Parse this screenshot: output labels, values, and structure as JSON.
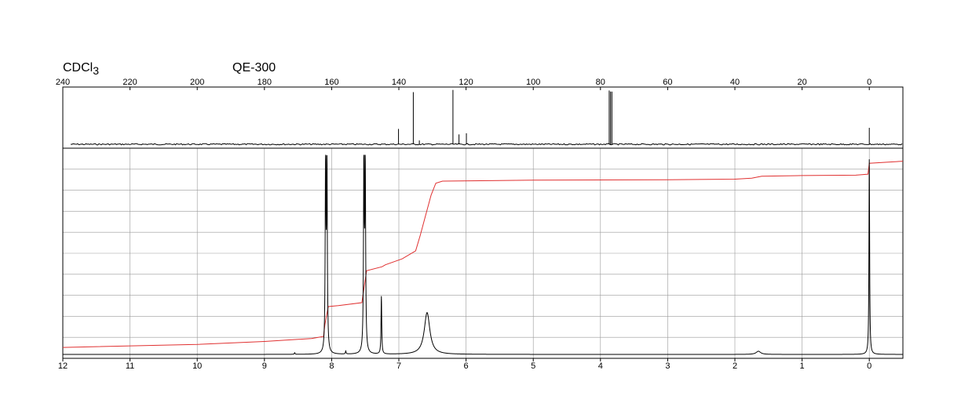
{
  "header": {
    "solvent": "CDCl",
    "solvent_subscript": "3",
    "instrument": "QE-300"
  },
  "chart_data": [
    {
      "type": "line",
      "title": "",
      "xlabel": "",
      "ylabel": "",
      "x_reversed": true,
      "xlim": [
        240,
        -10
      ],
      "xticks": [
        240,
        220,
        200,
        180,
        160,
        140,
        120,
        100,
        80,
        60,
        40,
        20,
        0
      ],
      "tick_labels": [
        "240",
        "220",
        "200",
        "180",
        "160",
        "140",
        "120",
        "100",
        "80",
        "60",
        "40",
        "20",
        "0"
      ],
      "ylim": [
        0,
        1
      ],
      "grid": false,
      "peaks": [
        {
          "x": 140.1,
          "y": 0.28
        },
        {
          "x": 135.7,
          "y": 0.95
        },
        {
          "x": 133.9,
          "y": 0.07
        },
        {
          "x": 123.9,
          "y": 0.99
        },
        {
          "x": 122.1,
          "y": 0.18
        },
        {
          "x": 119.9,
          "y": 0.2
        },
        {
          "x": 77.4,
          "y": 0.98
        },
        {
          "x": 77.0,
          "y": 0.96
        },
        {
          "x": 76.6,
          "y": 0.96
        },
        {
          "x": 0.0,
          "y": 0.3
        }
      ]
    },
    {
      "type": "line",
      "title": "",
      "xlabel": "",
      "ylabel": "",
      "x_reversed": true,
      "xlim": [
        12,
        -0.5
      ],
      "xticks": [
        12,
        11,
        10,
        9,
        8,
        7,
        6,
        5,
        4,
        3,
        2,
        1,
        0
      ],
      "tick_labels": [
        "12",
        "11",
        "10",
        "9",
        "8",
        "7",
        "6",
        "5",
        "4",
        "3",
        "2",
        "1",
        "0"
      ],
      "ylim": [
        0,
        1
      ],
      "grid": true,
      "series": [
        {
          "color": "#000000",
          "peaks": [
            {
              "x": 8.09,
              "y": 0.96,
              "w": 0.007
            },
            {
              "x": 8.07,
              "y": 0.94,
              "w": 0.007
            },
            {
              "x": 7.52,
              "y": 0.97,
              "w": 0.007
            },
            {
              "x": 7.5,
              "y": 0.95,
              "w": 0.007
            },
            {
              "x": 7.26,
              "y": 0.29,
              "w": 0.006
            },
            {
              "x": 6.58,
              "y": 0.21,
              "w": 0.05
            },
            {
              "x": 7.79,
              "y": 0.015,
              "w": 0.006
            },
            {
              "x": 8.55,
              "y": 0.008,
              "w": 0.006
            },
            {
              "x": 1.65,
              "y": 0.016,
              "w": 0.04
            },
            {
              "x": 0.0,
              "y": 0.98,
              "w": 0.006
            }
          ]
        },
        {
          "color": "#e03030",
          "integral": [
            [
              12.0,
              0.035
            ],
            [
              10.0,
              0.05
            ],
            [
              9.0,
              0.065
            ],
            [
              8.3,
              0.08
            ],
            [
              8.12,
              0.09
            ],
            [
              8.1,
              0.15
            ],
            [
              8.05,
              0.24
            ],
            [
              7.9,
              0.245
            ],
            [
              7.55,
              0.26
            ],
            [
              7.52,
              0.33
            ],
            [
              7.48,
              0.42
            ],
            [
              7.25,
              0.44
            ],
            [
              7.2,
              0.45
            ],
            [
              6.95,
              0.48
            ],
            [
              6.75,
              0.52
            ],
            [
              6.68,
              0.6
            ],
            [
              6.6,
              0.7
            ],
            [
              6.52,
              0.8
            ],
            [
              6.45,
              0.86
            ],
            [
              6.35,
              0.87
            ],
            [
              5.0,
              0.875
            ],
            [
              3.0,
              0.877
            ],
            [
              2.0,
              0.88
            ],
            [
              1.75,
              0.885
            ],
            [
              1.6,
              0.895
            ],
            [
              1.0,
              0.898
            ],
            [
              0.2,
              0.9
            ],
            [
              0.02,
              0.905
            ],
            [
              0.0,
              0.96
            ],
            [
              -0.5,
              0.97
            ]
          ]
        }
      ]
    }
  ]
}
